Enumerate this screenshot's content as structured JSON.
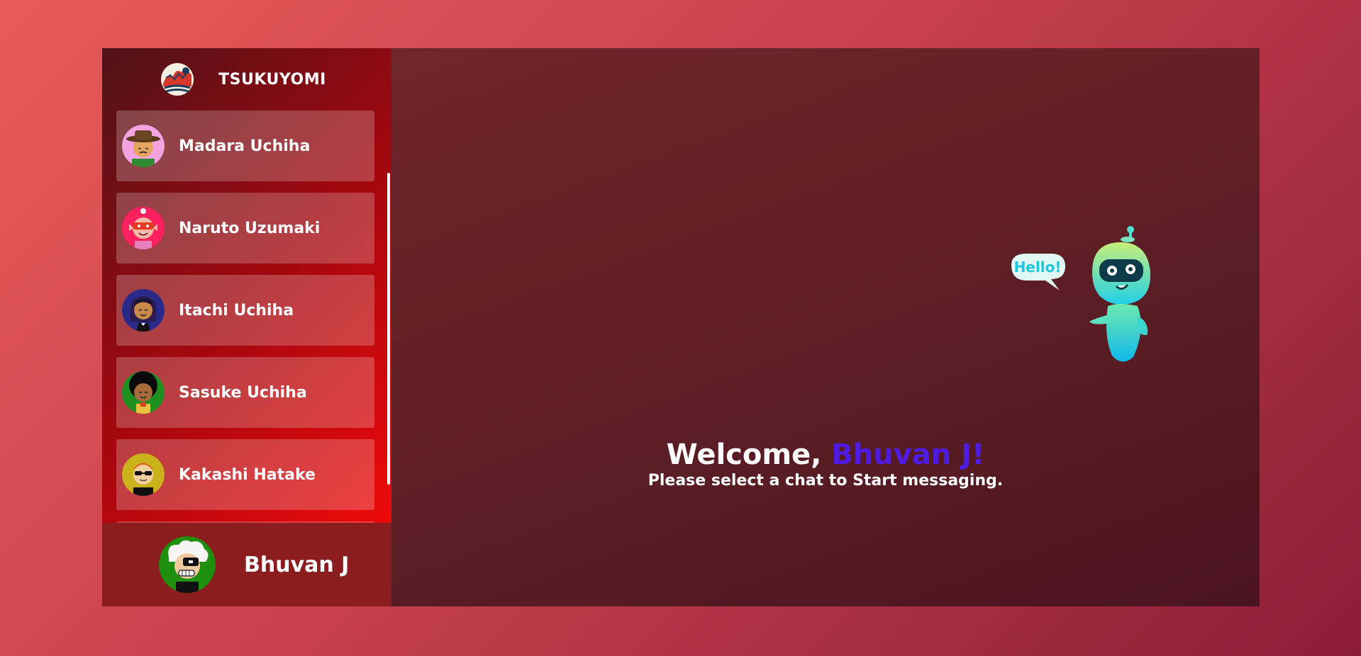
{
  "app": {
    "brand_name": "TSUKUYOMI",
    "brand_logo": "great-wave-icon"
  },
  "sidebar": {
    "contacts": [
      {
        "name": "Madara Uchiha",
        "avatar": "cowboy-avatar-icon",
        "avatar_bg": "#f2a3e0"
      },
      {
        "name": "Naruto Uzumaki",
        "avatar": "red-mask-avatar-icon",
        "avatar_bg": "#ff2060"
      },
      {
        "name": "Itachi Uchiha",
        "avatar": "braided-avatar-icon",
        "avatar_bg": "#2a2a8a"
      },
      {
        "name": "Sasuke Uchiha",
        "avatar": "afro-avatar-icon",
        "avatar_bg": "#1f8f1f"
      },
      {
        "name": "Kakashi Hatake",
        "avatar": "sunglasses-avatar-icon",
        "avatar_bg": "#c9b21a"
      }
    ]
  },
  "current_user": {
    "name": "Bhuvan J",
    "avatar": "einstein-avatar-icon",
    "avatar_bg": "#1e8f0e"
  },
  "main": {
    "welcome_prefix": "Welcome, ",
    "welcome_user": "Bhuvan J!",
    "subtitle": "Please select a chat to Start messaging.",
    "robot_bubble": "Hello!",
    "accent_color": "#4e1be0"
  }
}
